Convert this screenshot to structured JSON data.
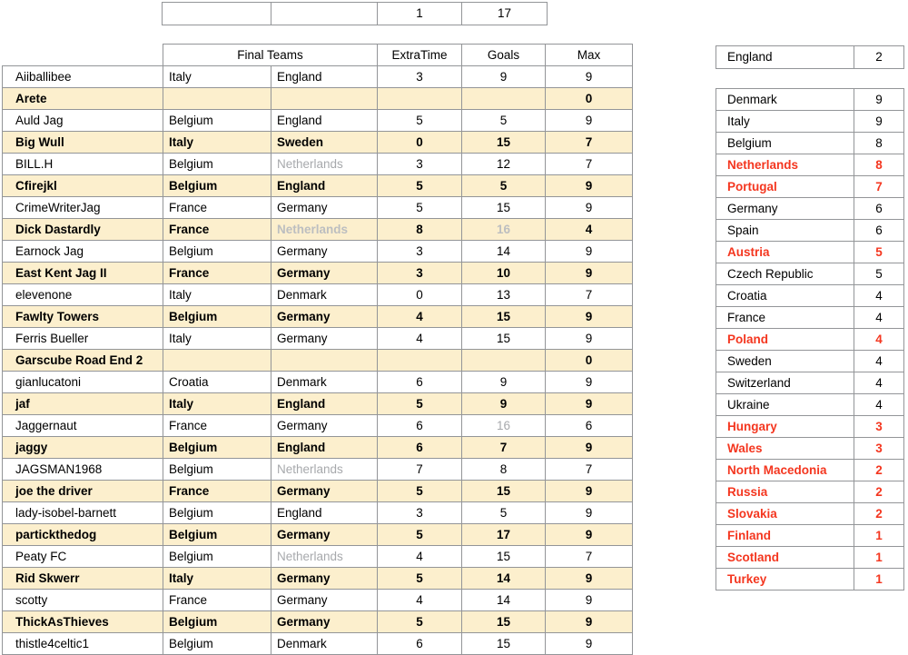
{
  "mini_table": {
    "name": "summary-row",
    "cells": [
      "",
      "",
      "1",
      "17"
    ]
  },
  "entries_table": {
    "headers": {
      "name": "",
      "final_teams": "Final Teams",
      "extra_time": "ExtraTime",
      "goals": "Goals",
      "max": "Max"
    },
    "rows": [
      {
        "name": "Aiiballibee",
        "team1": "Italy",
        "team2": "England",
        "team2_muted": false,
        "extra": "3",
        "goals": "9",
        "goals_muted": false,
        "max": "9",
        "alt": false
      },
      {
        "name": "Arete",
        "team1": "",
        "team2": "",
        "team2_muted": false,
        "extra": "",
        "goals": "",
        "goals_muted": false,
        "max": "0",
        "alt": true
      },
      {
        "name": "Auld Jag",
        "team1": "Belgium",
        "team2": "England",
        "team2_muted": false,
        "extra": "5",
        "goals": "5",
        "goals_muted": false,
        "max": "9",
        "alt": false
      },
      {
        "name": "Big Wull",
        "team1": "Italy",
        "team2": "Sweden",
        "team2_muted": false,
        "extra": "0",
        "goals": "15",
        "goals_muted": false,
        "max": "7",
        "alt": true
      },
      {
        "name": "BILL.H",
        "team1": "Belgium",
        "team2": "Netherlands",
        "team2_muted": true,
        "extra": "3",
        "goals": "12",
        "goals_muted": false,
        "max": "7",
        "alt": false
      },
      {
        "name": "Cfirejkl",
        "team1": "Belgium",
        "team2": "England",
        "team2_muted": false,
        "extra": "5",
        "goals": "5",
        "goals_muted": false,
        "max": "9",
        "alt": true
      },
      {
        "name": "CrimeWriterJag",
        "team1": "France",
        "team2": "Germany",
        "team2_muted": false,
        "extra": "5",
        "goals": "15",
        "goals_muted": false,
        "max": "9",
        "alt": false
      },
      {
        "name": "Dick Dastardly",
        "team1": "France",
        "team2": "Netherlands",
        "team2_muted": true,
        "extra": "8",
        "goals": "16",
        "goals_muted": true,
        "max": "4",
        "alt": true
      },
      {
        "name": "Earnock Jag",
        "team1": "Belgium",
        "team2": "Germany",
        "team2_muted": false,
        "extra": "3",
        "goals": "14",
        "goals_muted": false,
        "max": "9",
        "alt": false
      },
      {
        "name": "East Kent Jag II",
        "team1": "France",
        "team2": "Germany",
        "team2_muted": false,
        "extra": "3",
        "goals": "10",
        "goals_muted": false,
        "max": "9",
        "alt": true
      },
      {
        "name": "elevenone",
        "team1": "Italy",
        "team2": "Denmark",
        "team2_muted": false,
        "extra": "0",
        "goals": "13",
        "goals_muted": false,
        "max": "7",
        "alt": false
      },
      {
        "name": "Fawlty Towers",
        "team1": "Belgium",
        "team2": "Germany",
        "team2_muted": false,
        "extra": "4",
        "goals": "15",
        "goals_muted": false,
        "max": "9",
        "alt": true
      },
      {
        "name": "Ferris Bueller",
        "team1": "Italy",
        "team2": "Germany",
        "team2_muted": false,
        "extra": "4",
        "goals": "15",
        "goals_muted": false,
        "max": "9",
        "alt": false
      },
      {
        "name": "Garscube Road End 2",
        "team1": "",
        "team2": "",
        "team2_muted": false,
        "extra": "",
        "goals": "",
        "goals_muted": false,
        "max": "0",
        "alt": true
      },
      {
        "name": "gianlucatoni",
        "team1": "Croatia",
        "team2": "Denmark",
        "team2_muted": false,
        "extra": "6",
        "goals": "9",
        "goals_muted": false,
        "max": "9",
        "alt": false
      },
      {
        "name": "jaf",
        "team1": "Italy",
        "team2": "England",
        "team2_muted": false,
        "extra": "5",
        "goals": "9",
        "goals_muted": false,
        "max": "9",
        "alt": true
      },
      {
        "name": "Jaggernaut",
        "team1": "France",
        "team2": "Germany",
        "team2_muted": false,
        "extra": "6",
        "goals": "16",
        "goals_muted": true,
        "max": "6",
        "alt": false
      },
      {
        "name": "jaggy",
        "team1": "Belgium",
        "team2": "England",
        "team2_muted": false,
        "extra": "6",
        "goals": "7",
        "goals_muted": false,
        "max": "9",
        "alt": true
      },
      {
        "name": "JAGSMAN1968",
        "team1": "Belgium",
        "team2": "Netherlands",
        "team2_muted": true,
        "extra": "7",
        "goals": "8",
        "goals_muted": false,
        "max": "7",
        "alt": false
      },
      {
        "name": "joe the driver",
        "team1": "France",
        "team2": "Germany",
        "team2_muted": false,
        "extra": "5",
        "goals": "15",
        "goals_muted": false,
        "max": "9",
        "alt": true
      },
      {
        "name": "lady-isobel-barnett",
        "team1": "Belgium",
        "team2": "England",
        "team2_muted": false,
        "extra": "3",
        "goals": "5",
        "goals_muted": false,
        "max": "9",
        "alt": false
      },
      {
        "name": "partickthedog",
        "team1": "Belgium",
        "team2": "Germany",
        "team2_muted": false,
        "extra": "5",
        "goals": "17",
        "goals_muted": false,
        "max": "9",
        "alt": true
      },
      {
        "name": "Peaty FC",
        "team1": "Belgium",
        "team2": "Netherlands",
        "team2_muted": true,
        "extra": "4",
        "goals": "15",
        "goals_muted": false,
        "max": "7",
        "alt": false
      },
      {
        "name": "Rid Skwerr",
        "team1": "Italy",
        "team2": "Germany",
        "team2_muted": false,
        "extra": "5",
        "goals": "14",
        "goals_muted": false,
        "max": "9",
        "alt": true
      },
      {
        "name": "scotty",
        "team1": "France",
        "team2": "Germany",
        "team2_muted": false,
        "extra": "4",
        "goals": "14",
        "goals_muted": false,
        "max": "9",
        "alt": false
      },
      {
        "name": "ThickAsThieves",
        "team1": "Belgium",
        "team2": "Germany",
        "team2_muted": false,
        "extra": "5",
        "goals": "15",
        "goals_muted": false,
        "max": "9",
        "alt": true
      },
      {
        "name": "thistle4celtic1",
        "team1": "Belgium",
        "team2": "Denmark",
        "team2_muted": false,
        "extra": "6",
        "goals": "15",
        "goals_muted": false,
        "max": "9",
        "alt": false
      }
    ]
  },
  "england_table": {
    "rows": [
      {
        "country": "England",
        "count": "2",
        "red": false
      }
    ]
  },
  "countries_table": {
    "rows": [
      {
        "country": "Denmark",
        "count": "9",
        "red": false
      },
      {
        "country": "Italy",
        "count": "9",
        "red": false
      },
      {
        "country": "Belgium",
        "count": "8",
        "red": false
      },
      {
        "country": "Netherlands",
        "count": "8",
        "red": true
      },
      {
        "country": "Portugal",
        "count": "7",
        "red": true
      },
      {
        "country": "Germany",
        "count": "6",
        "red": false
      },
      {
        "country": "Spain",
        "count": "6",
        "red": false
      },
      {
        "country": "Austria",
        "count": "5",
        "red": true
      },
      {
        "country": "Czech Republic",
        "count": "5",
        "red": false
      },
      {
        "country": "Croatia",
        "count": "4",
        "red": false
      },
      {
        "country": "France",
        "count": "4",
        "red": false
      },
      {
        "country": "Poland",
        "count": "4",
        "red": true
      },
      {
        "country": "Sweden",
        "count": "4",
        "red": false
      },
      {
        "country": "Switzerland",
        "count": "4",
        "red": false
      },
      {
        "country": "Ukraine",
        "count": "4",
        "red": false
      },
      {
        "country": "Hungary",
        "count": "3",
        "red": true
      },
      {
        "country": "Wales",
        "count": "3",
        "red": true
      },
      {
        "country": "North Macedonia",
        "count": "2",
        "red": true
      },
      {
        "country": "Russia",
        "count": "2",
        "red": true
      },
      {
        "country": "Slovakia",
        "count": "2",
        "red": true
      },
      {
        "country": "Finland",
        "count": "1",
        "red": true
      },
      {
        "country": "Scotland",
        "count": "1",
        "red": true
      },
      {
        "country": "Turkey",
        "count": "1",
        "red": true
      }
    ]
  },
  "colors": {
    "highlight_row": "#FCEFCD",
    "muted_text": "#A7A9AC",
    "red_text": "#F4361F",
    "border": "#939598"
  }
}
